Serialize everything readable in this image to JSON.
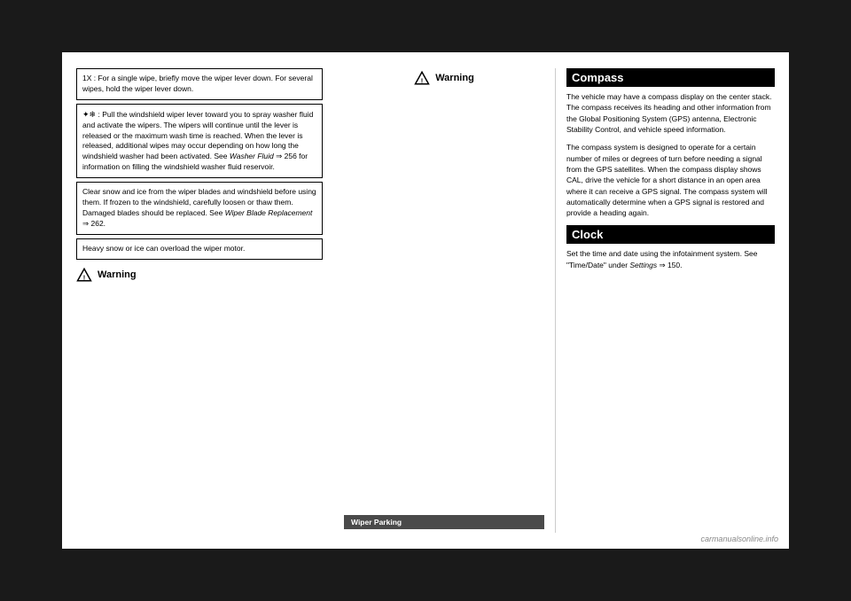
{
  "page": {
    "background": "#1a1a1a",
    "paper_bg": "#ffffff"
  },
  "left": {
    "box1": {
      "content": "1X : For a single wipe, briefly move the wiper lever down. For several wipes, hold the wiper lever down."
    },
    "box2": {
      "icon": "✦❄",
      "content": ": Pull the windshield wiper lever toward you to spray washer fluid and activate the wipers. The wipers will continue until the lever is released or the maximum wash time is reached. When the lever is released, additional wipes may occur depending on how long the windshield washer had been activated. See Washer Fluid ⇒ 256 for information on filling the windshield washer fluid reservoir."
    },
    "box3": {
      "content": "Clear snow and ice from the wiper blades and windshield before using them. If frozen to the windshield, carefully loosen or thaw them. Damaged blades should be replaced. See Wiper Blade Replacement ⇒ 262."
    },
    "box4": {
      "content": "Heavy snow or ice can overload the wiper motor."
    },
    "warning_label": "Warning"
  },
  "middle": {
    "warning_label": "Warning",
    "wiper_parking_label": "Wiper Parking"
  },
  "right": {
    "compass": {
      "heading": "Compass",
      "para1": "The vehicle may have a compass display on the center stack. The compass receives its heading and other information from the Global Positioning System (GPS) antenna, Electronic Stability Control, and vehicle speed information.",
      "para2": "The compass system is designed to operate for a certain number of miles or degrees of turn before needing a signal from the GPS satellites. When the compass display shows CAL, drive the vehicle for a short distance in an open area where it can receive a GPS signal. The compass system will automatically determine when a GPS signal is restored and provide a heading again."
    },
    "clock": {
      "heading": "Clock",
      "para1": "Set the time and date using the infotainment system. See \"Time/Date\" under Settings ⇒ 150."
    }
  },
  "watermark": "carmanualsonline.info",
  "icons": {
    "warning_triangle": "⚠",
    "warning_triangle_label": "warning-triangle-icon"
  }
}
